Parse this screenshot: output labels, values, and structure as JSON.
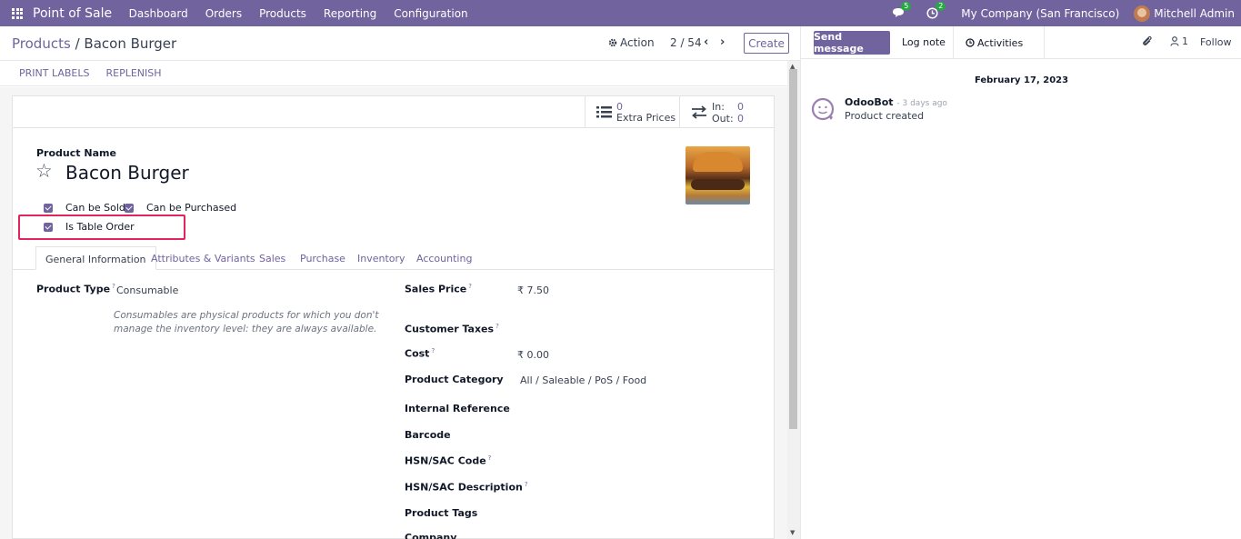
{
  "navbar": {
    "app_name": "Point of Sale",
    "menu": [
      "Dashboard",
      "Orders",
      "Products",
      "Reporting",
      "Configuration"
    ],
    "messages_count": "5",
    "activities_count": "2",
    "company": "My Company (San Francisco)",
    "user": "Mitchell Admin"
  },
  "control": {
    "breadcrumb_parent": "Products",
    "breadcrumb_separator": "/",
    "breadcrumb_current": "Bacon Burger",
    "action_label": "Action",
    "pager": "2 / 54",
    "create_label": "Create"
  },
  "status_buttons": [
    "PRINT LABELS",
    "REPLENISH"
  ],
  "smart_buttons": {
    "extra_prices_count": "0",
    "extra_prices_label": "Extra Prices",
    "in_label": "In:",
    "in_value": "0",
    "out_label": "Out:",
    "out_value": "0"
  },
  "product": {
    "name_label": "Product Name",
    "name": "Bacon Burger",
    "can_be_sold": "Can be Sold",
    "can_be_purchased": "Can be Purchased",
    "is_table_order": "Is Table Order"
  },
  "tabs": [
    "General Information",
    "Attributes & Variants",
    "Sales",
    "Purchase",
    "Inventory",
    "Accounting"
  ],
  "general": {
    "product_type_label": "Product Type",
    "product_type_value": "Consumable",
    "product_type_help": "Consumables are physical products for which you don't manage the inventory level: they are always available.",
    "sales_price_label": "Sales Price",
    "sales_price_value": "₹ 7.50",
    "customer_taxes_label": "Customer Taxes",
    "cost_label": "Cost",
    "cost_value": "₹ 0.00",
    "category_label": "Product Category",
    "category_value": "All / Saleable / PoS / Food",
    "internal_ref_label": "Internal Reference",
    "barcode_label": "Barcode",
    "hsn_code_label": "HSN/SAC Code",
    "hsn_desc_label": "HSN/SAC Description",
    "tags_label": "Product Tags",
    "company_label": "Company",
    "help_mark": "?"
  },
  "chatter": {
    "send_message": "Send message",
    "log_note": "Log note",
    "activities": "Activities",
    "followers_count": "1",
    "follow": "Follow",
    "date": "February 17, 2023",
    "author": "OdooBot",
    "time": "- 3 days ago",
    "body": "Product created"
  },
  "colors": {
    "brand": "#71639e",
    "highlight": "#e0245e",
    "badge": "#28a745"
  }
}
